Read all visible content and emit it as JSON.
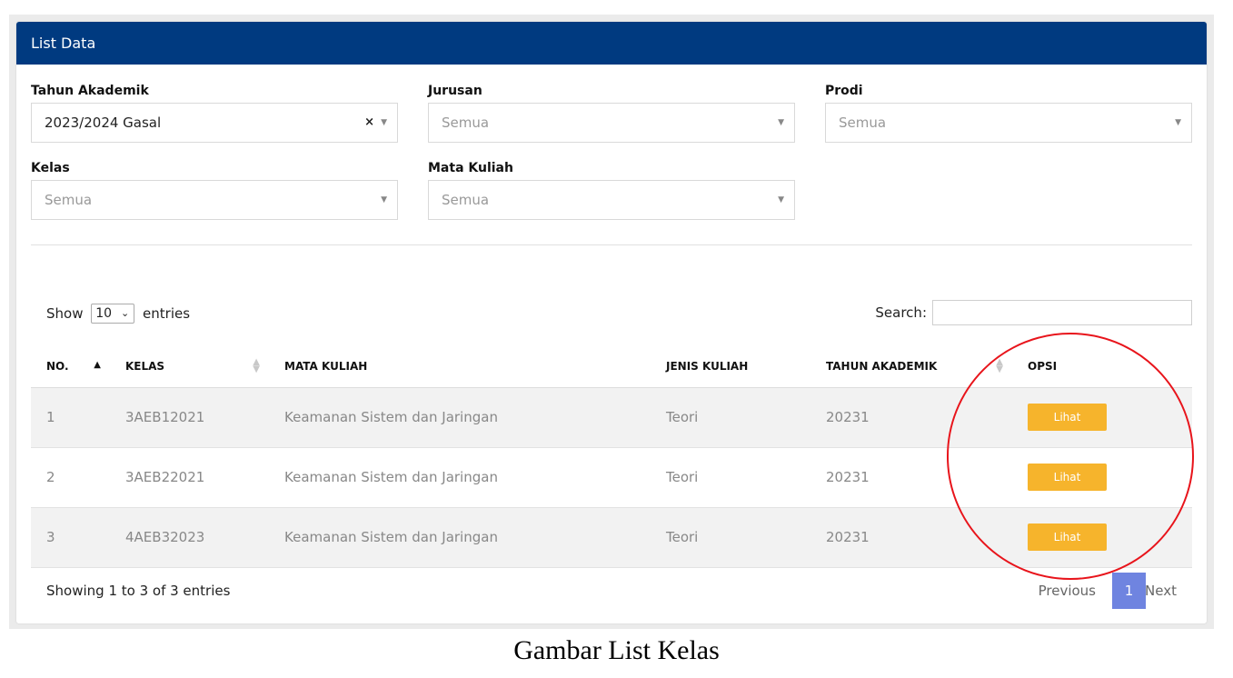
{
  "card": {
    "title": "List Data"
  },
  "filters": {
    "tahun_akademik": {
      "label": "Tahun Akademik",
      "value": "2023/2024 Gasal",
      "clear_icon": "×"
    },
    "jurusan": {
      "label": "Jurusan",
      "value": "Semua"
    },
    "prodi": {
      "label": "Prodi",
      "value": "Semua"
    },
    "kelas": {
      "label": "Kelas",
      "value": "Semua"
    },
    "mata_kuliah": {
      "label": "Mata Kuliah",
      "value": "Semua"
    }
  },
  "datatable": {
    "show_label": "Show",
    "length_value": "10",
    "entries_label": "entries",
    "search_label": "Search:",
    "search_value": "",
    "columns": [
      "NO.",
      "KELAS",
      "MATA KULIAH",
      "JENIS KULIAH",
      "TAHUN AKADEMIK",
      "OPSI"
    ],
    "rows": [
      {
        "no": "1",
        "kelas": "3AEB12021",
        "mata_kuliah": "Keamanan Sistem dan Jaringan",
        "jenis": "Teori",
        "tahun": "20231",
        "action": "Lihat"
      },
      {
        "no": "2",
        "kelas": "3AEB22021",
        "mata_kuliah": "Keamanan Sistem dan Jaringan",
        "jenis": "Teori",
        "tahun": "20231",
        "action": "Lihat"
      },
      {
        "no": "3",
        "kelas": "4AEB32023",
        "mata_kuliah": "Keamanan Sistem dan Jaringan",
        "jenis": "Teori",
        "tahun": "20231",
        "action": "Lihat"
      }
    ],
    "info": "Showing 1 to 3 of 3 entries",
    "pagination": {
      "previous": "Previous",
      "current": "1",
      "next": "Next"
    }
  },
  "caption": "Gambar List Kelas",
  "colors": {
    "header_bg": "#003a80",
    "button_bg": "#f6b42c",
    "active_page": "#6f84e0",
    "annotation": "#e8141b"
  },
  "icons": {
    "dropdown": "caret-down-icon",
    "clear": "clear-x-icon",
    "sort": "sort-arrows-icon"
  }
}
